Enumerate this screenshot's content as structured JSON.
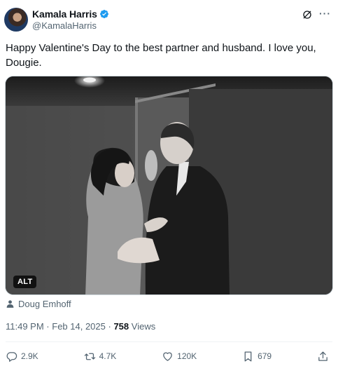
{
  "author": {
    "display_name": "Kamala Harris",
    "handle": "@KamalaHarris",
    "verified_icon": "verified-badge-icon",
    "avatar_icon": "avatar"
  },
  "header_actions": {
    "grok_icon": "grok-icon",
    "more_icon": "more-icon",
    "more_label": "···"
  },
  "tweet": {
    "text": "Happy Valentine's Day to the best partner and husband. I love you, Dougie.",
    "media_alt_badge": "ALT",
    "tagged_person": "Doug Emhoff"
  },
  "meta": {
    "time": "11:49 PM",
    "separator": " · ",
    "date": "Feb 14, 2025",
    "views_count": "758",
    "views_label": "Views"
  },
  "actions": {
    "replies": "2.9K",
    "reposts": "4.7K",
    "likes": "120K",
    "bookmarks": "679"
  },
  "colors": {
    "text_primary": "#0f1419",
    "text_secondary": "#536471",
    "verified_blue": "#1d9bf0",
    "divider": "#eff3f4"
  }
}
